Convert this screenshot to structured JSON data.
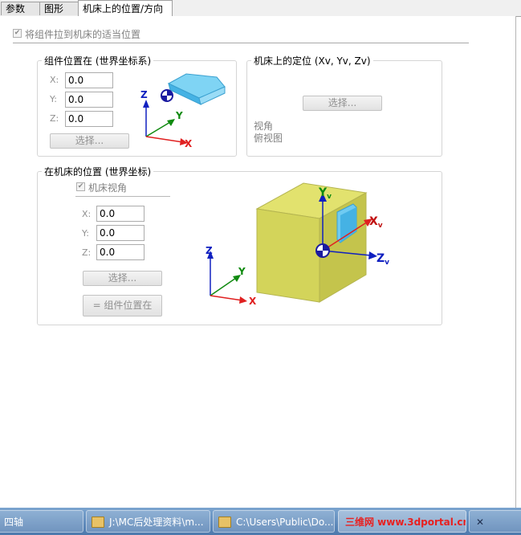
{
  "tabs": [
    {
      "label": "参数"
    },
    {
      "label": "图形"
    },
    {
      "label": "机床上的位置/方向"
    }
  ],
  "main_checkbox": {
    "label": "将组件拉到机床的适当位置",
    "checked": true
  },
  "component_position": {
    "title": "组件位置在 (世界坐标系)",
    "x_label": "X:",
    "x_value": "0.0",
    "y_label": "Y:",
    "y_value": "0.0",
    "z_label": "Z:",
    "z_value": "0.0",
    "select_label": "选择..."
  },
  "machine_positioning": {
    "title": "机床上的定位 (Xv, Yv, Zv)",
    "select_label": "选择...",
    "view_label": "视角",
    "view_value": "俯视图"
  },
  "machine_position": {
    "title": "在机床的位置 (世界坐标)",
    "checkbox_label": "机床视角",
    "checked": true,
    "x_label": "X:",
    "x_value": "0.0",
    "y_label": "Y:",
    "y_value": "0.0",
    "z_label": "Z:",
    "z_value": "0.0",
    "select_label": "选择...",
    "equal_label": "= 组件位置在"
  },
  "axes": {
    "x": "X",
    "y": "Y",
    "z": "Z",
    "xv": "X",
    "yv": "Y",
    "zv": "Z",
    "sub": "v"
  },
  "taskbar": {
    "item1": "四轴",
    "item2": "J:\\MC后处理资料\\m...",
    "item3": "C:\\Users\\Public\\Do...",
    "item4": "三维网 www.3dportal.cn"
  },
  "colors": {
    "accent": "#4a90d9",
    "x_axis": "#e02020",
    "y_axis": "#108a10",
    "z_axis": "#1020c0"
  }
}
